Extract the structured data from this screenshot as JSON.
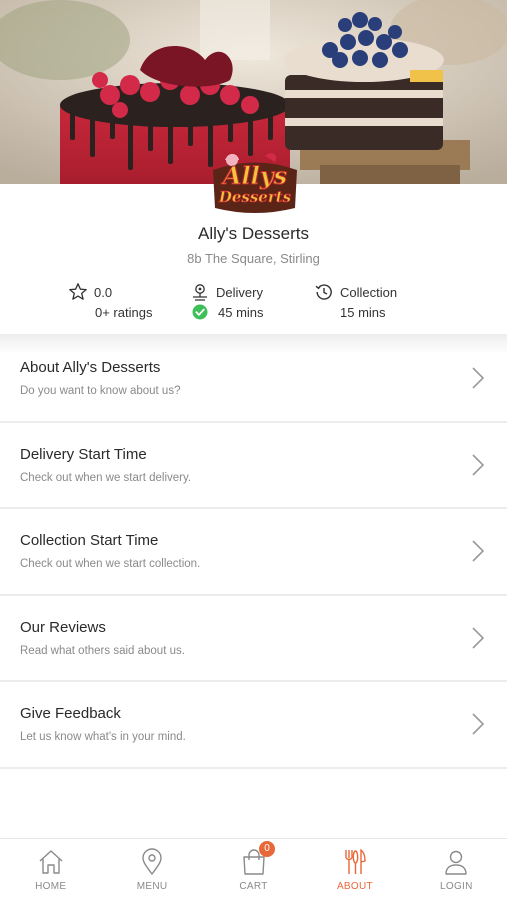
{
  "restaurant": {
    "name": "Ally's Desserts",
    "address": "8b The Square, Stirling",
    "logo_line1": "Allys",
    "logo_line2": "Desserts"
  },
  "stats": {
    "rating_value": "0.0",
    "rating_count": "0+ ratings",
    "delivery_label": "Delivery",
    "delivery_time": "45 mins",
    "collection_label": "Collection",
    "collection_time": "15 mins"
  },
  "menu": [
    {
      "title": "About Ally's Desserts",
      "desc": "Do you want to know about us?"
    },
    {
      "title": "Delivery Start Time",
      "desc": "Check out when we start delivery."
    },
    {
      "title": "Collection Start Time",
      "desc": "Check out when we start collection."
    },
    {
      "title": "Our Reviews",
      "desc": "Read what others said about us."
    },
    {
      "title": "Give Feedback",
      "desc": "Let us know what's in your mind."
    }
  ],
  "nav": {
    "home": "HOME",
    "menu": "MENU",
    "cart": "CART",
    "cart_count": "0",
    "about": "ABOUT",
    "login": "LOGIN",
    "active": "about"
  },
  "colors": {
    "accent": "#e8683a",
    "check_green": "#3fbf5a",
    "text_muted": "#8a8a8a"
  },
  "icons": [
    "star-icon",
    "delivery-pin-icon",
    "check-circle-icon",
    "clock-history-icon",
    "chevron-right-icon",
    "home-icon",
    "map-pin-icon",
    "shopping-bag-icon",
    "fork-knife-icon",
    "user-icon"
  ]
}
